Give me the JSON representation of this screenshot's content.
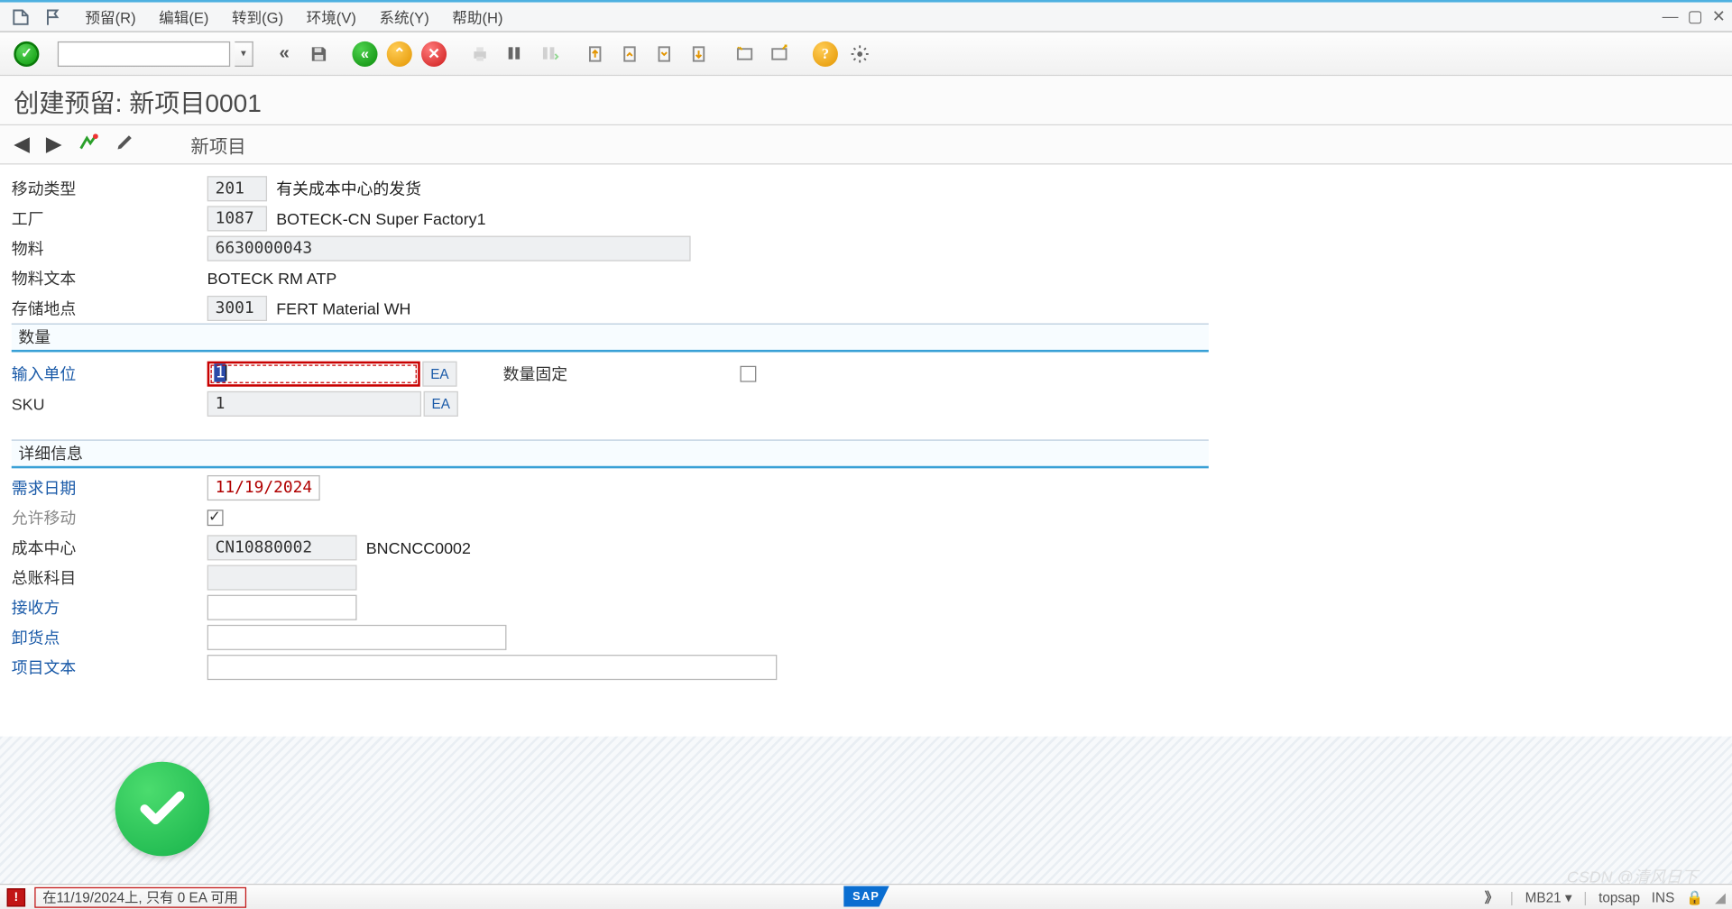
{
  "menu": {
    "reserve": "预留(R)",
    "edit": "编辑(E)",
    "goto": "转到(G)",
    "env": "环境(V)",
    "system": "系统(Y)",
    "help": "帮助(H)"
  },
  "title": "创建预留: 新项目0001",
  "subbar": {
    "newitem": "新项目"
  },
  "header": {
    "mvt_label": "移动类型",
    "mvt_code": "201",
    "mvt_desc": "有关成本中心的发货",
    "plant_label": "工厂",
    "plant_code": "1087",
    "plant_desc": "BOTECK-CN Super Factory1",
    "mat_label": "物料",
    "mat_code": "6630000043",
    "mattext_label": "物料文本",
    "mattext_val": "BOTECK RM ATP",
    "storloc_label": "存储地点",
    "storloc_code": "3001",
    "storloc_desc": "FERT Material WH"
  },
  "qty": {
    "section": "数量",
    "unitentry_label": "输入单位",
    "unitentry_val": "1",
    "unitentry_uom": "EA",
    "qtyfixed_label": "数量固定",
    "qtyfixed_checked": false,
    "sku_label": "SKU",
    "sku_val": "1",
    "sku_uom": "EA"
  },
  "detail": {
    "section": "详细信息",
    "reqdate_label": "需求日期",
    "reqdate_val": "11/19/2024",
    "allowmove_label": "允许移动",
    "allowmove_checked": true,
    "costcenter_label": "成本中心",
    "costcenter_code": "CN10880002",
    "costcenter_desc": "BNCNCC0002",
    "gl_label": "总账科目",
    "gl_val": "",
    "recipient_label": "接收方",
    "recipient_val": "",
    "unload_label": "卸货点",
    "unload_val": "",
    "itemtext_label": "项目文本",
    "itemtext_val": ""
  },
  "status": {
    "error": "在11/19/2024上, 只有 0 EA 可用",
    "more": "》",
    "tcode": "MB21",
    "user": "topsap",
    "ins": "INS"
  },
  "watermark": "CSDN @清风日下",
  "sap": "SAP"
}
